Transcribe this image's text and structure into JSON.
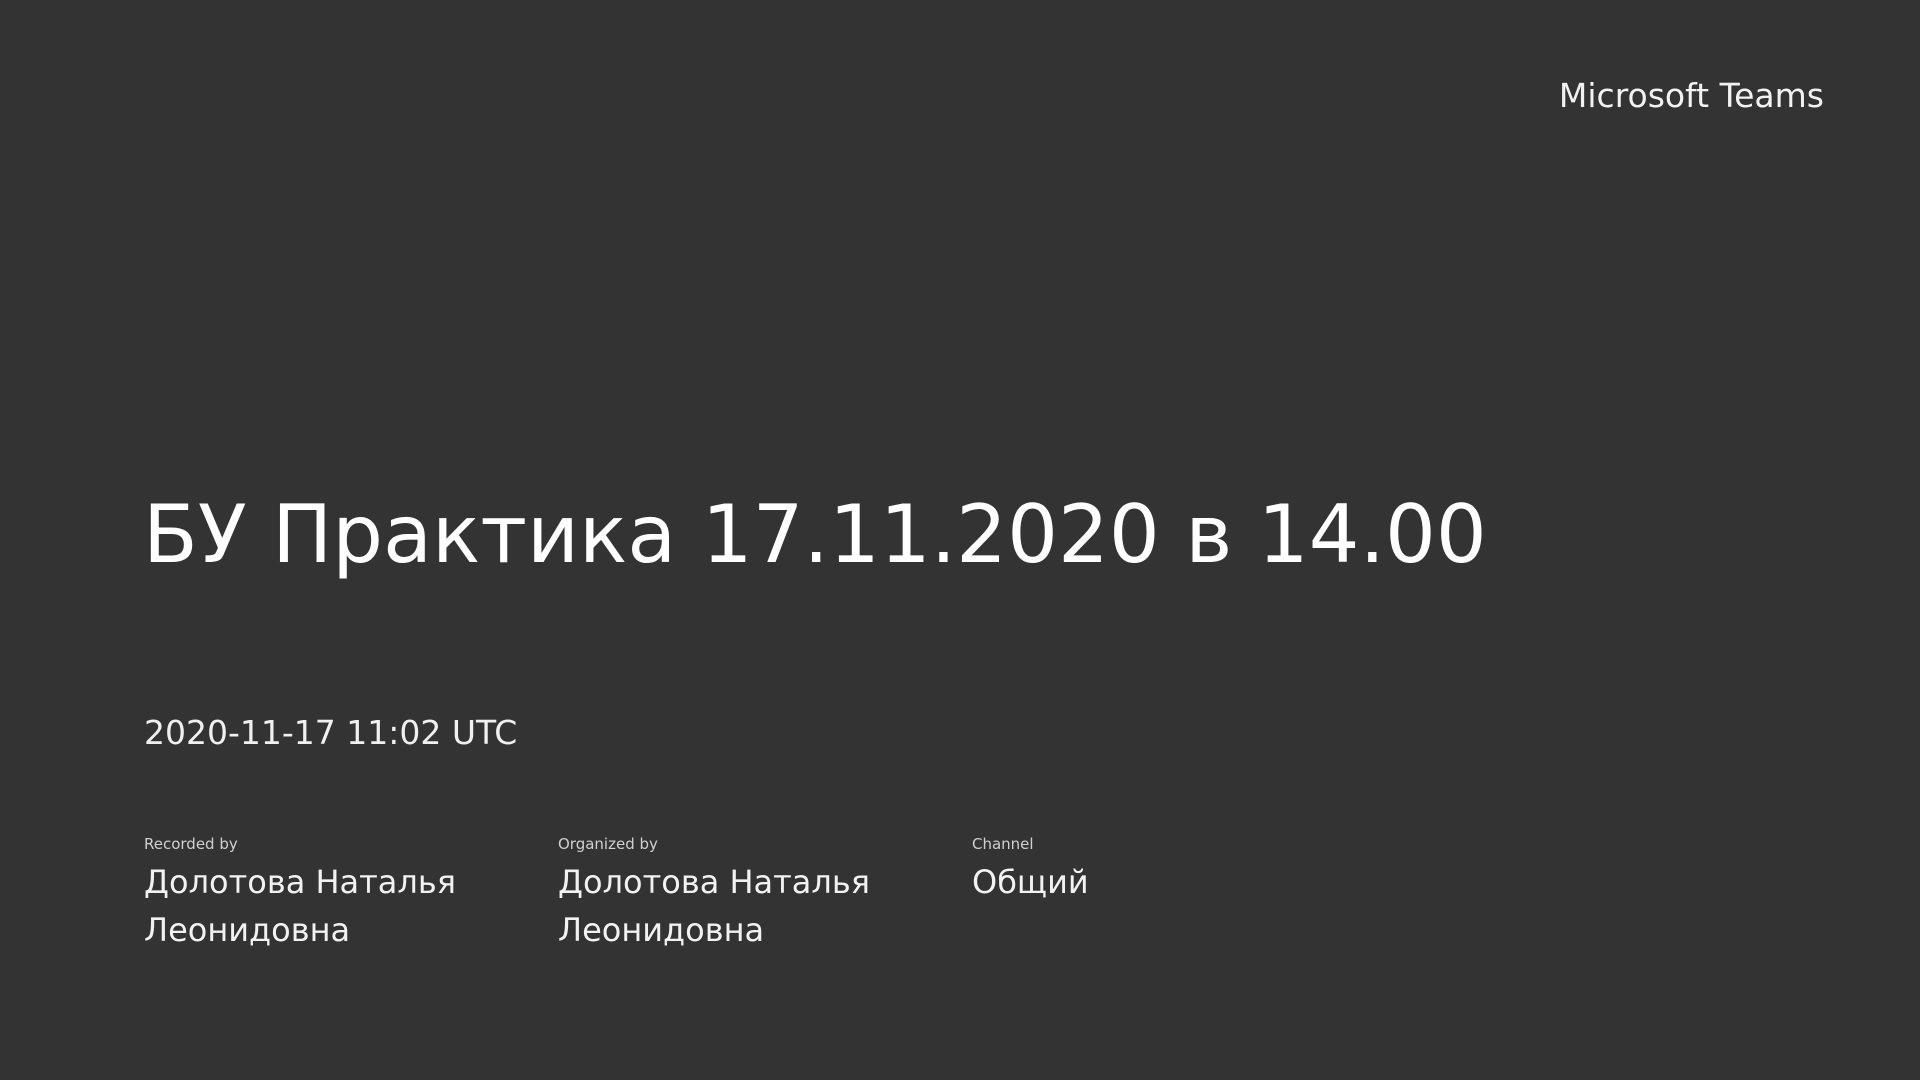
{
  "brand": "Microsoft Teams",
  "title": "БУ Практика 17.11.2020 в 14.00",
  "datetime": "2020-11-17 11:02 UTC",
  "meta": {
    "recorded_by": {
      "label": "Recorded by",
      "value": "Долотова Наталья Леонидовна"
    },
    "organized_by": {
      "label": "Organized by",
      "value": "Долотова Наталья Леонидовна"
    },
    "channel": {
      "label": "Channel",
      "value": "Общий"
    }
  },
  "colors": {
    "background": "#333333",
    "text": "#ffffff"
  }
}
